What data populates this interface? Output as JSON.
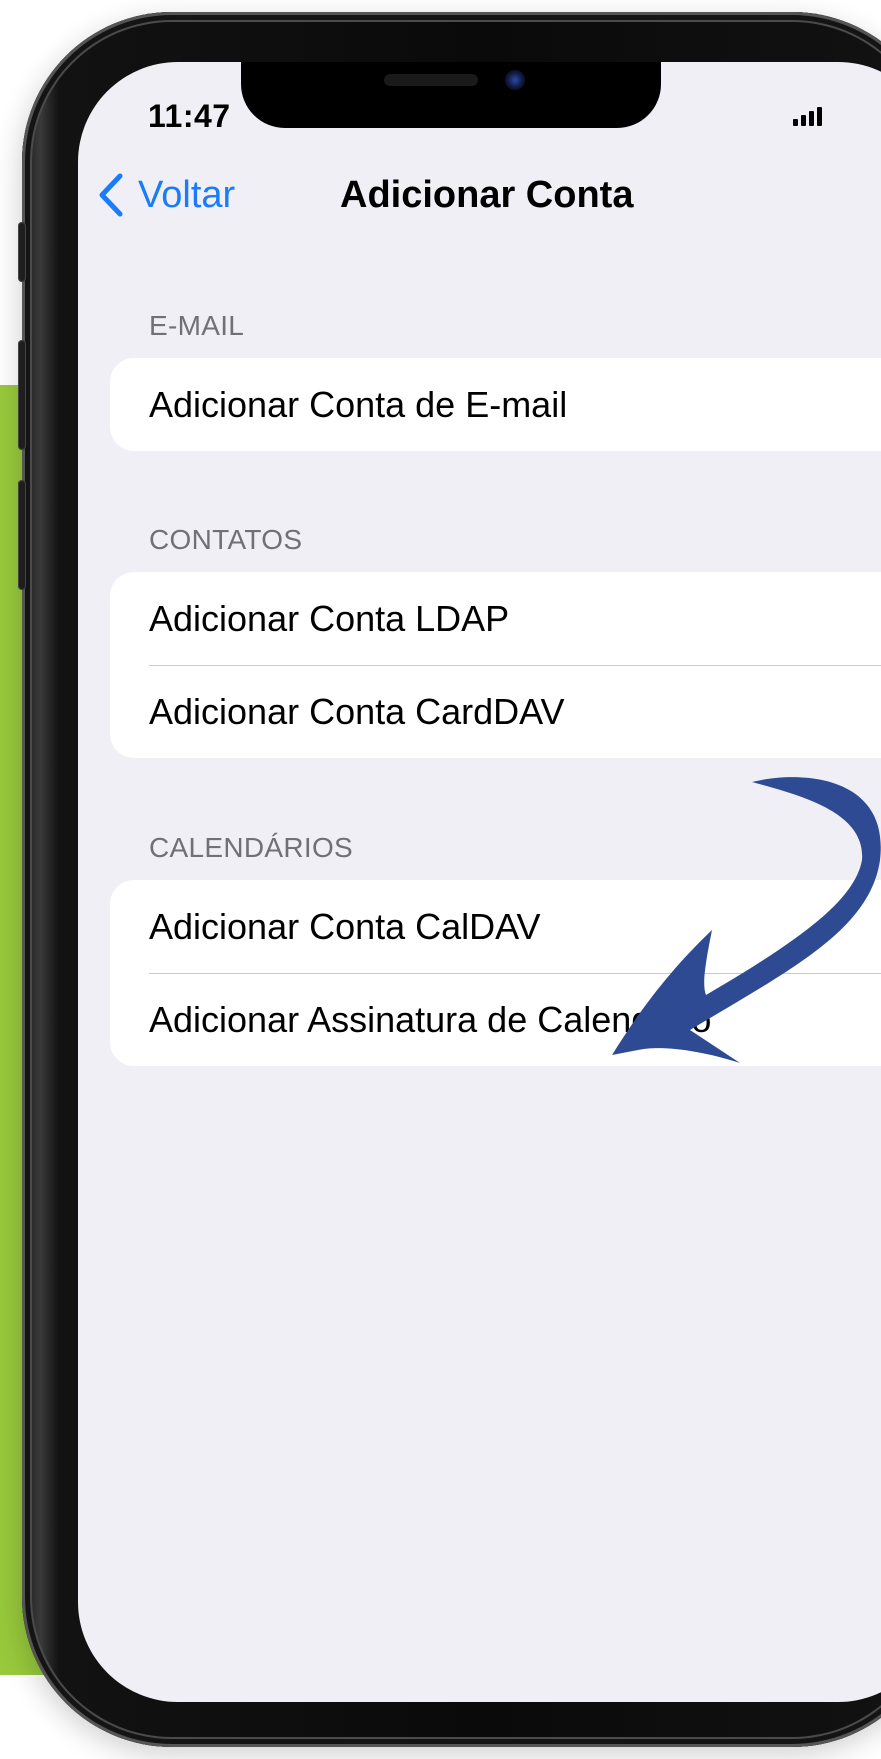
{
  "status_bar": {
    "time": "11:47"
  },
  "nav": {
    "back_label": "Voltar",
    "title": "Adicionar Conta"
  },
  "sections": [
    {
      "header": "E-MAIL",
      "items": [
        {
          "label": "Adicionar Conta de E-mail"
        }
      ]
    },
    {
      "header": "CONTATOS",
      "items": [
        {
          "label": "Adicionar Conta LDAP"
        },
        {
          "label": "Adicionar Conta CardDAV"
        }
      ]
    },
    {
      "header": "CALENDÁRIOS",
      "items": [
        {
          "label": "Adicionar Conta CalDAV"
        },
        {
          "label": "Adicionar Assinatura de Calendário"
        }
      ]
    }
  ],
  "colors": {
    "accent": "#1a7cf6",
    "background_panel": "#98c93c",
    "arrow": "#2d4a93",
    "screen_background": "#f0eff5"
  },
  "icons": {
    "back": "chevron-left-icon",
    "signal": "cellular-signal-icon",
    "annotation": "curved-arrow-icon"
  }
}
